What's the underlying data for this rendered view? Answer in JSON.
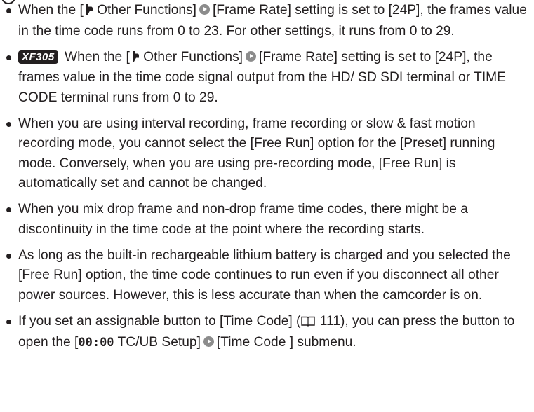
{
  "notes": [
    {
      "t1": "When the [",
      "t2": " Other Functions]",
      "t3": "[Frame Rate] setting is set to [24P], the frames value in the time code runs from 0 to 23. For other settings, it runs from 0 to 29."
    },
    {
      "badge": "XF305",
      "t1": " When the [",
      "t2": " Other Functions]",
      "t3": "[Frame Rate] setting is set to [24P], the frames value in the time code signal output from the HD/ SD SDI terminal or TIME CODE terminal runs from 0 to 29."
    },
    {
      "t1": "When you are using interval recording, frame recording or slow & fast motion recording mode, you cannot select the [Free Run] option for the [Preset] running mode. Conversely, when you are using pre-recording mode, [Free Run] is automatically set and cannot be changed."
    },
    {
      "t1": "When you mix drop frame and non-drop frame time codes, there might be a discontinuity in the time code at the point where the recording starts."
    },
    {
      "t1": "As long as the built-in rechargeable lithium battery is charged and you selected the [Free Run] option, the time code continues to run even if you disconnect all other power sources. However, this is less accurate than when the camcorder is on."
    },
    {
      "t1": "If you set an assignable button to [Time Code] (",
      "t2": " 111), you can press the button to open the [",
      "tc": "00:00",
      "t3": " TC/UB Setup]",
      "t4": "[Time Code ] submenu."
    }
  ]
}
